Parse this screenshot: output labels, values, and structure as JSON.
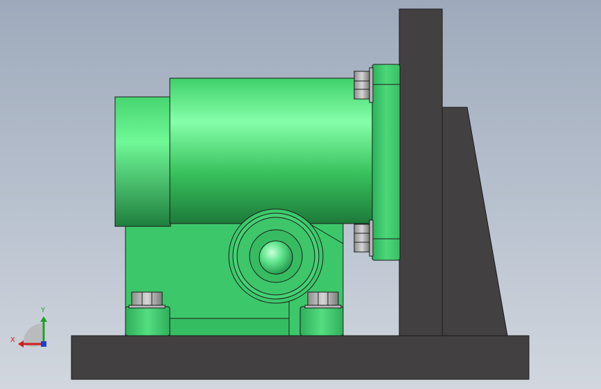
{
  "triad": {
    "x_label": "X",
    "y_label": "Y",
    "x_color": "#cc1f1f",
    "y_color": "#1fa02a",
    "z_color": "#1f3fcc"
  },
  "colors": {
    "model_green": "#3fcf6f",
    "base_gray": "#434042",
    "edge": "#1a1a1a"
  },
  "icons": [
    "view-orientation-triad-icon"
  ]
}
